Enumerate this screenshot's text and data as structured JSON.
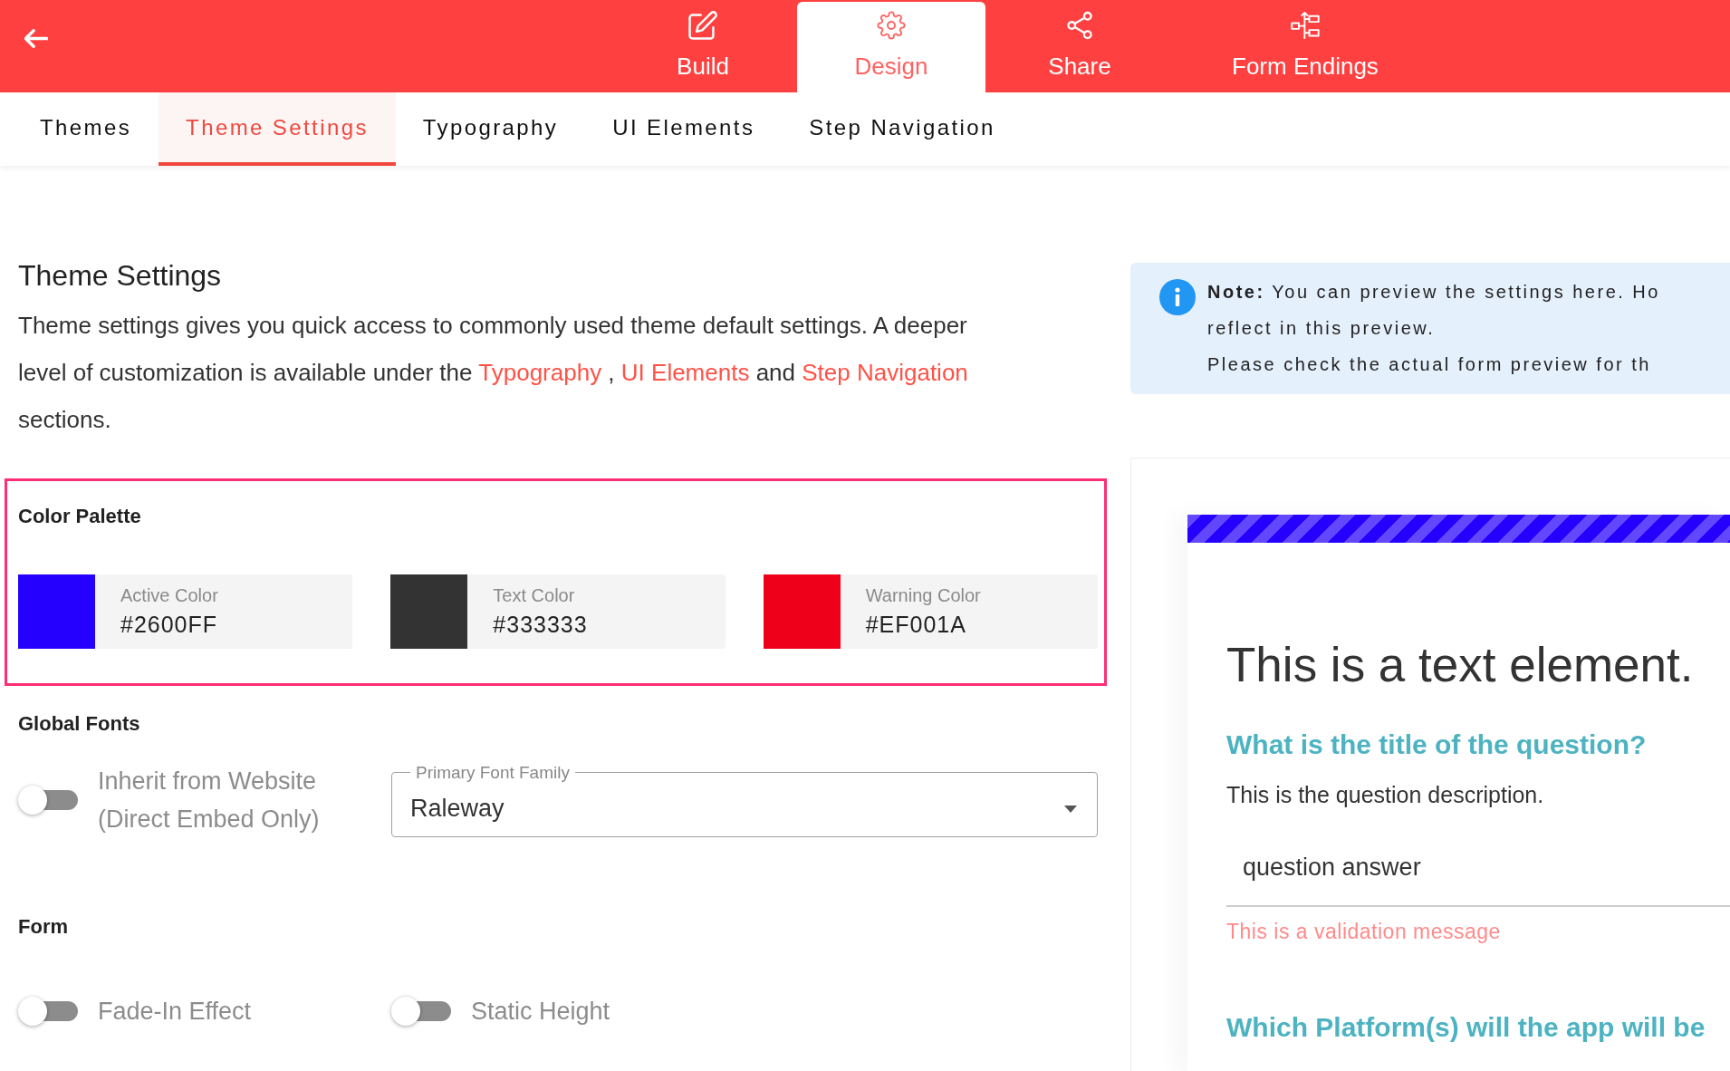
{
  "header": {
    "nav_tabs": [
      {
        "label": "Build",
        "selected": false
      },
      {
        "label": "Design",
        "selected": true
      },
      {
        "label": "Share",
        "selected": false
      },
      {
        "label": "Form Endings",
        "selected": false
      }
    ]
  },
  "sub_tabs": [
    {
      "label": "Themes",
      "selected": false
    },
    {
      "label": "Theme Settings",
      "selected": true
    },
    {
      "label": "Typography",
      "selected": false
    },
    {
      "label": "UI Elements",
      "selected": false
    },
    {
      "label": "Step Navigation",
      "selected": false
    }
  ],
  "intro": {
    "title": "Theme Settings",
    "parts": [
      {
        "kind": "text",
        "text": "Theme settings gives you quick access to commonly used theme default settings. A deeper level of customization is available under the "
      },
      {
        "kind": "link",
        "text": "Typography"
      },
      {
        "kind": "text",
        "text": " , "
      },
      {
        "kind": "link",
        "text": "UI Elements"
      },
      {
        "kind": "text",
        "text": " and "
      },
      {
        "kind": "link",
        "text": "Step Navigation"
      },
      {
        "kind": "text",
        "text": " sections."
      }
    ]
  },
  "color_palette": {
    "title": "Color Palette",
    "highlighted": true,
    "colors": [
      {
        "label": "Active Color",
        "value": "#2600FF",
        "color": "#2600ff"
      },
      {
        "label": "Text Color",
        "value": "#333333",
        "color": "#333333"
      },
      {
        "label": "Warning Color",
        "value": "#EF001A",
        "color": "#ef001a"
      }
    ]
  },
  "global_fonts": {
    "title": "Global Fonts",
    "toggle": {
      "label": "Inherit from Website (Direct Embed Only)",
      "on": false
    },
    "select": {
      "label": "Primary Font Family",
      "value": "Raleway"
    }
  },
  "form": {
    "title": "Form",
    "toggles": [
      {
        "label": "Fade-In Effect",
        "on": false
      },
      {
        "label": "Static Height",
        "on": false
      }
    ]
  },
  "note": {
    "lines": [
      "**Note:** You can preview the settings here. Ho",
      "reflect in this preview.",
      "Please check the actual form preview for th"
    ]
  },
  "preview": {
    "text_element": "This is a text element.",
    "questions": [
      {
        "title": "What is the title of the question?",
        "description": "This is the question description.",
        "answer": "question answer",
        "validation": "This is a validation message"
      },
      {
        "title": "Which Platform(s) will the app will be"
      }
    ]
  }
}
